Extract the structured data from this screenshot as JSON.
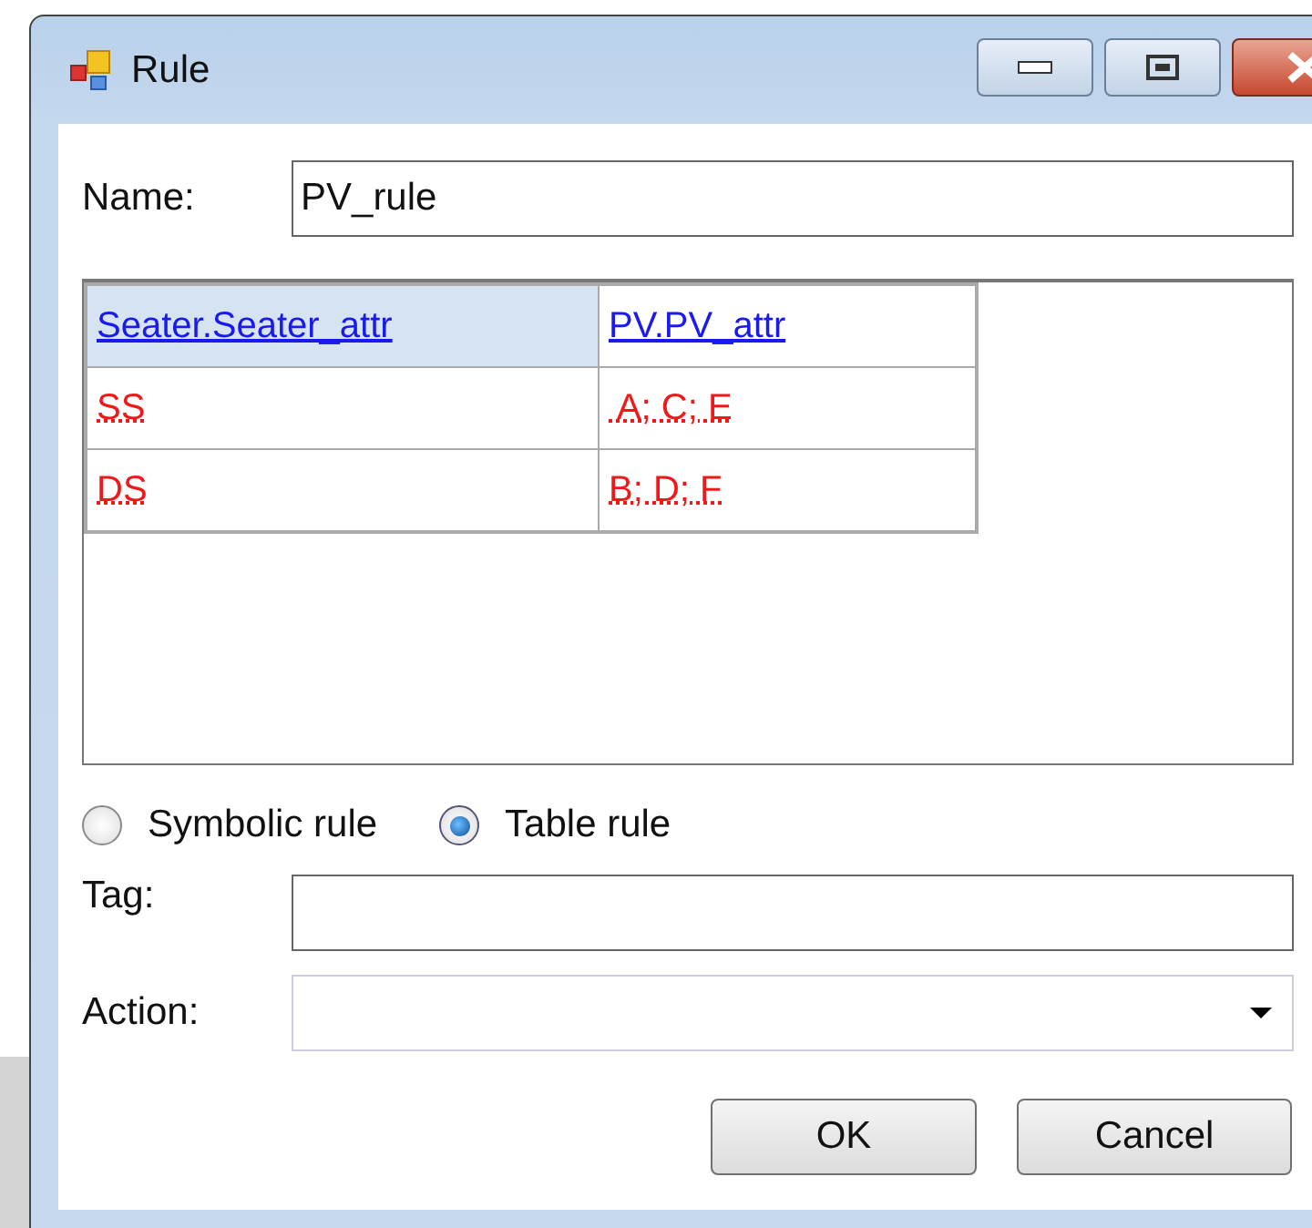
{
  "window": {
    "title": "Rule"
  },
  "name_field": {
    "label": "Name:",
    "value": "PV_rule"
  },
  "grid": {
    "columns": [
      {
        "label": "Seater.Seater_attr",
        "selected": true
      },
      {
        "label": "PV.PV_attr",
        "selected": false
      }
    ],
    "rows": [
      [
        {
          "text": "SS",
          "flagged": true
        },
        {
          "text": " A; C; E",
          "flagged": true
        }
      ],
      [
        {
          "text": "DS",
          "flagged": true
        },
        {
          "text": "B; D; F",
          "flagged": true
        }
      ]
    ]
  },
  "rule_type": [
    {
      "label": "Symbolic rule",
      "selected": false
    },
    {
      "label": "Table rule",
      "selected": true
    }
  ],
  "tag_field": {
    "label": "Tag:"
  },
  "action_field": {
    "label": "Action:"
  },
  "buttons": [
    "OK",
    "Cancel"
  ]
}
